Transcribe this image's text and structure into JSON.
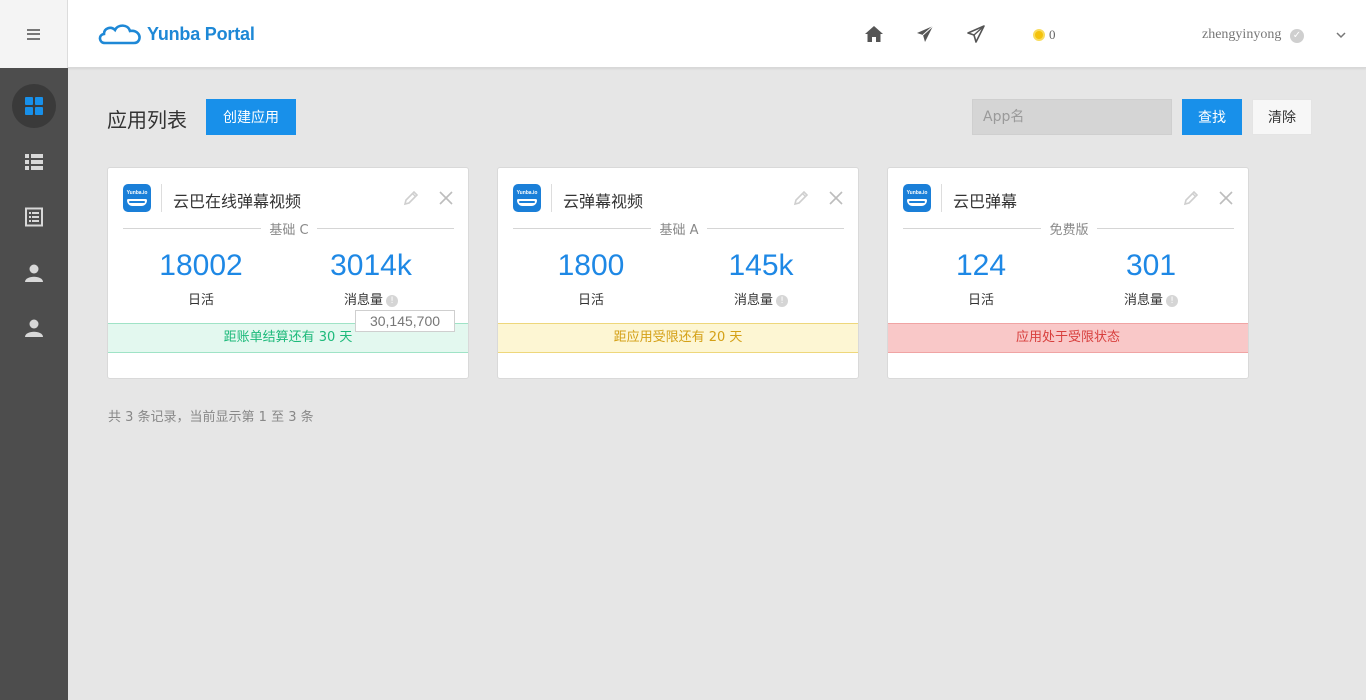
{
  "header": {
    "logo_text": "Yunba Portal",
    "coin_count": "0",
    "username": "zhengyinyong",
    "nav_icons": [
      "home-icon",
      "send-icon",
      "send-outline-icon"
    ],
    "brand_color": "#1890ea"
  },
  "sidebar": {
    "items": [
      {
        "icon": "dashboard-icon",
        "active": true
      },
      {
        "icon": "list-icon",
        "active": false
      },
      {
        "icon": "document-icon",
        "active": false
      },
      {
        "icon": "user-icon",
        "active": false
      },
      {
        "icon": "user-icon",
        "active": false
      }
    ]
  },
  "main": {
    "title": "应用列表",
    "create_button": "创建应用",
    "search_placeholder": "App名",
    "search_button": "查找",
    "clear_button": "清除",
    "footer": "共 3 条记录，当前显示第 1 至 3 条"
  },
  "cards": [
    {
      "name": "云巴在线弹幕视频",
      "plan": "基础 C",
      "daily_active_value": "18002",
      "daily_active_label": "日活",
      "messages_value": "3014k",
      "messages_label": "消息量",
      "status": "距账单结算还有 30 天",
      "status_type": "green"
    },
    {
      "name": "云弹幕视频",
      "plan": "基础 A",
      "daily_active_value": "1800",
      "daily_active_label": "日活",
      "messages_value": "145k",
      "messages_label": "消息量",
      "status": "距应用受限还有 20 天",
      "status_type": "yellow"
    },
    {
      "name": "云巴弹幕",
      "plan": "免费版",
      "daily_active_value": "124",
      "daily_active_label": "日活",
      "messages_value": "301",
      "messages_label": "消息量",
      "status": "应用处于受限状态",
      "status_type": "red"
    }
  ],
  "tooltip": {
    "text": "30,145,700"
  },
  "app_icon_text": "Yunba.io"
}
